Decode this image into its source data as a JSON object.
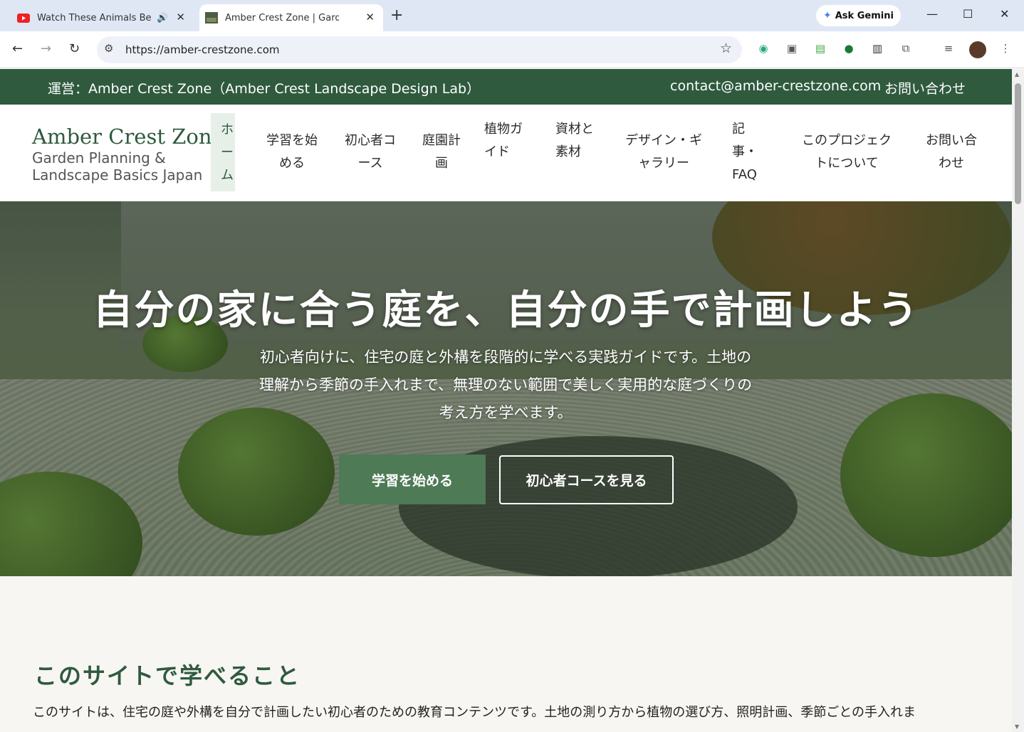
{
  "browser": {
    "tabs": [
      {
        "title": "Watch These Animals Being",
        "active": false,
        "icon": "youtube-icon",
        "audio": true
      },
      {
        "title": "Amber Crest Zone | Garden Plar",
        "active": true,
        "icon": "site-favicon"
      }
    ],
    "url": "https://amber-crestzone.com",
    "gemini_label": "Ask Gemini",
    "colors": {
      "tabbar": "#dfe7f5",
      "active_tab": "#ffffff"
    }
  },
  "topbar": {
    "operator": "運営：Amber Crest Zone（Amber Crest Landscape Design Lab）",
    "email": "contact@amber-crestzone.com",
    "contact": "お問い合わせ"
  },
  "header": {
    "logo_title": "Amber Crest Zone",
    "logo_subtitle": "Garden Planning & Landscape Basics Japan",
    "nav": [
      {
        "label": "ホーム"
      },
      {
        "label": "学習を始める"
      },
      {
        "label": "初心者コース"
      },
      {
        "label": "庭園計画"
      },
      {
        "label": "植物ガイド"
      },
      {
        "label": "資材と素材"
      },
      {
        "label": "デザイン・ギャラリー"
      },
      {
        "label": "記事・FAQ"
      },
      {
        "label": "このプロジェクトについて"
      },
      {
        "label": "お問い合わせ"
      }
    ]
  },
  "hero": {
    "title": "自分の家に合う庭を、自分の手で計画しよう",
    "subtitle": "初心者向けに、住宅の庭と外構を段階的に学べる実践ガイドです。土地の理解から季節の手入れまで、無理のない範囲で美しく実用的な庭づくりの考え方を学べます。",
    "primary_button": "学習を始める",
    "secondary_button": "初心者コースを見る"
  },
  "section": {
    "title": "このサイトで学べること",
    "text": "このサイトは、住宅の庭や外構を自分で計画したい初心者のための教育コンテンツです。土地の測り方から植物の選び方、照明計画、季節ごとの手入れま"
  },
  "theme": {
    "brand_green": "#2f5a3e",
    "button_green": "#4e7a55",
    "page_bg": "#f7f6f2"
  }
}
